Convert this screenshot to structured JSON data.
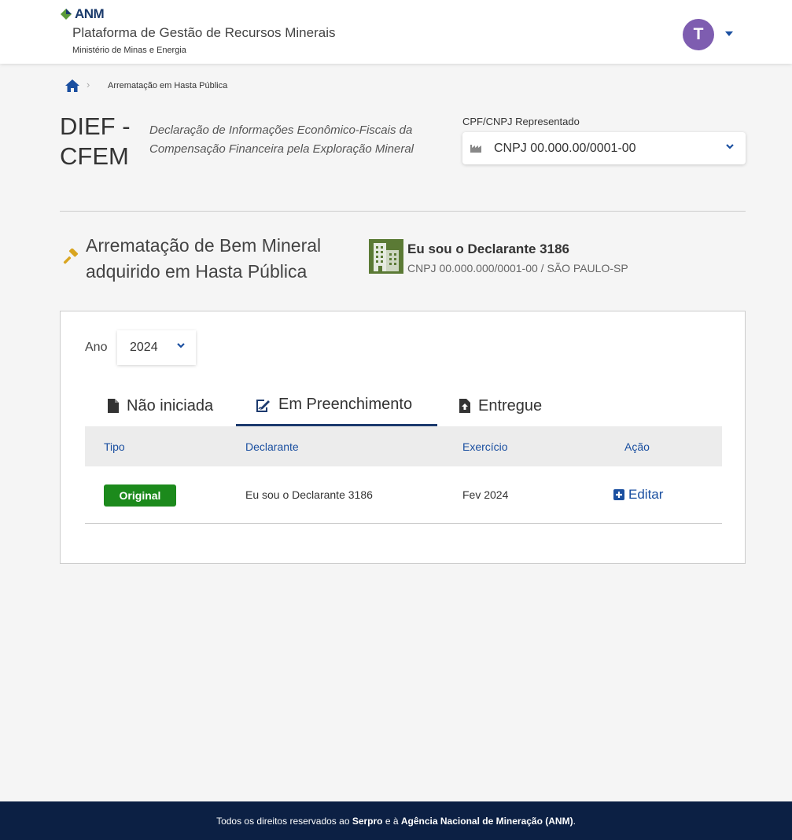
{
  "header": {
    "logo_text": "ANM",
    "platform_title": "Plataforma de Gestão de Recursos Minerais",
    "ministry": "Ministério de Minas e Energia",
    "avatar_initial": "T"
  },
  "breadcrumb": {
    "home_icon": "home-icon",
    "current": "Arrematação em Hasta Pública"
  },
  "page": {
    "title": "DIEF - CFEM",
    "description": "Declaração de Informações Econômico-Fiscais da Compensação Financeira pela Exploração Mineral",
    "cnpj_label": "CPF/CNPJ Representado",
    "cnpj_value": "CNPJ 00.000.00/0001-00"
  },
  "section": {
    "title": "Arrematação de Bem Mineral adquirido em Hasta Pública",
    "declarant_name": "Eu sou o Declarante 3186",
    "declarant_info": "CNPJ 00.000.000/0001-00 / SÃO PAULO-SP"
  },
  "filter": {
    "ano_label": "Ano",
    "ano_value": "2024"
  },
  "tabs": [
    {
      "label": "Não iniciada",
      "icon": "file-icon",
      "active": false
    },
    {
      "label": "Em Preenchimento",
      "icon": "file-signature-icon",
      "active": true
    },
    {
      "label": "Entregue",
      "icon": "file-upload-icon",
      "active": false
    }
  ],
  "table": {
    "headers": [
      "Tipo",
      "Declarante",
      "Exercício",
      "Ação"
    ],
    "rows": [
      {
        "tipo": "Original",
        "declarante": "Eu sou o Declarante 3186",
        "exercicio": "Fev 2024",
        "acao": "Editar"
      }
    ]
  },
  "footer": {
    "prefix": "Todos os direitos reservados ao ",
    "serpro": "Serpro",
    "middle": " e à ",
    "anm": "Agência Nacional de Mineração (ANM)",
    "suffix": "."
  },
  "colors": {
    "accent_blue": "#1a4fa0",
    "navy": "#0c2044",
    "avatar": "#7e5db0",
    "badge_green": "#1c8a1c",
    "building_green": "#5b7a35",
    "gavel_gold": "#d9a520"
  }
}
